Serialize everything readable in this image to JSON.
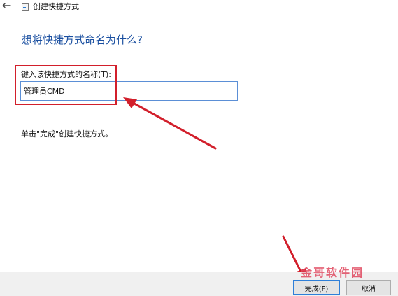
{
  "window": {
    "title": "创建快捷方式",
    "back_icon": "←"
  },
  "page": {
    "heading": "想将快捷方式命名为什么?",
    "field_label": "键入该快捷方式的名称(T):",
    "field_value": "管理员CMD",
    "instruction": "单击\"完成\"创建快捷方式。"
  },
  "buttons": {
    "finish": "完成(F)",
    "cancel": "取消"
  },
  "watermark": "金哥软件园",
  "colors": {
    "heading": "#1a4fa0",
    "annotation": "#d21f2b",
    "focus": "#2f7fd8"
  }
}
